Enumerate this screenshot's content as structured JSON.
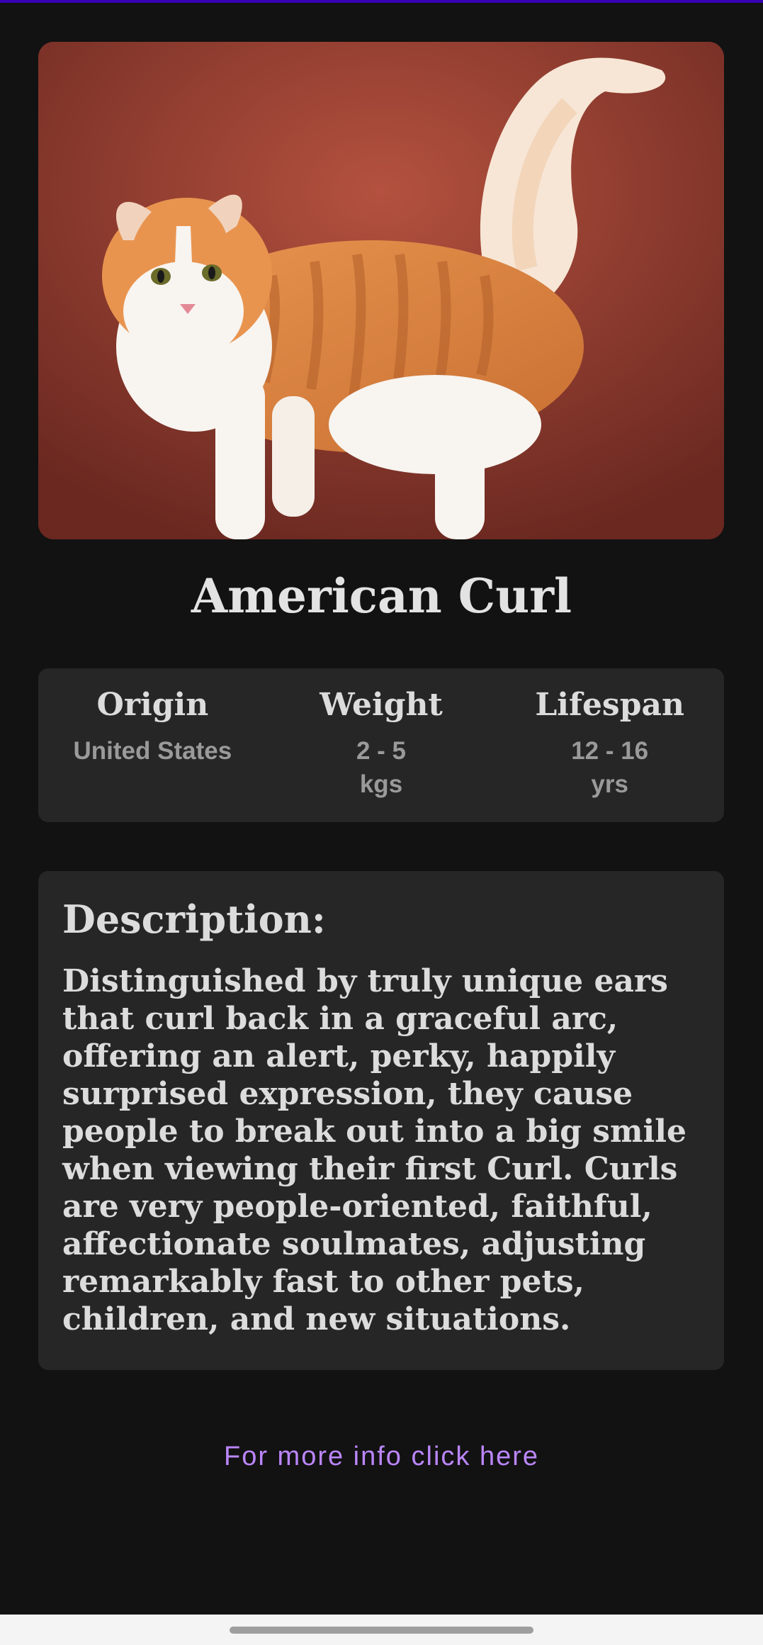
{
  "breed": {
    "name": "American Curl",
    "image_alt": "orange and white cat"
  },
  "stats": [
    {
      "title": "Origin",
      "value": "United States"
    },
    {
      "title": "Weight",
      "value": "2 - 5 kgs"
    },
    {
      "title": "Lifespan",
      "value": "12 - 16 yrs"
    }
  ],
  "description": {
    "heading": "Description:",
    "text": "Distinguished by truly unique ears that curl back in a graceful arc, offering an alert, perky, happily surprised expression, they cause people to break out into a big smile when viewing their first Curl. Curls are very people-oriented, faithful, affectionate soulmates, adjusting remarkably fast to other pets, children, and new situations."
  },
  "link": {
    "label": "For more info click here"
  },
  "colors": {
    "background": "#121212",
    "card": "#262626",
    "accent": "#bb86fc",
    "status_accent": "#3700b3"
  }
}
